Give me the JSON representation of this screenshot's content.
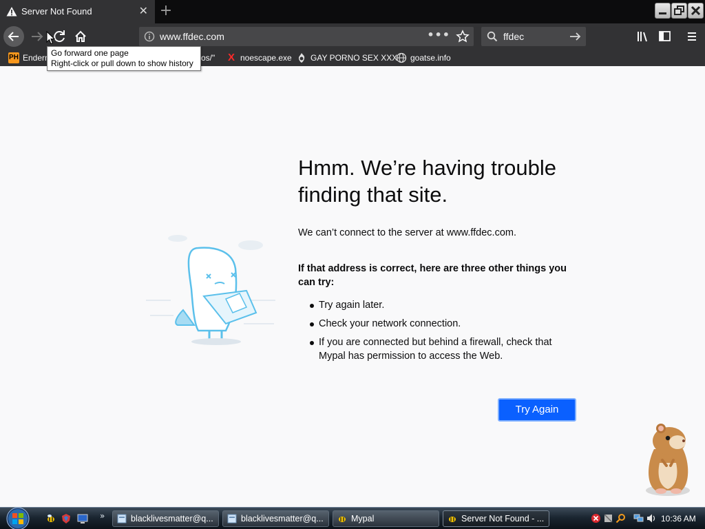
{
  "tab": {
    "title": "Server Not Found"
  },
  "navbar": {
    "url_host": "www.ffdec.com",
    "search_value": "ffdec"
  },
  "bookmarks": [
    {
      "label": "Endern"
    },
    {
      "label": "os/\""
    },
    {
      "label": "noescape.exe"
    },
    {
      "label": "GAY PORNO SEX XXX"
    },
    {
      "label": "goatse.info"
    }
  ],
  "bookmark_icons": {
    "ph": "PH",
    "x": "X"
  },
  "tooltip": {
    "line1": "Go forward one page",
    "line2": "Right-click or pull down to show history"
  },
  "error": {
    "title": "Hmm. We’re having trouble finding that site.",
    "short": "We can’t connect to the server at www.ffdec.com.",
    "bold": "If that address is correct, here are three other things you can try:",
    "items": [
      "Try again later.",
      "Check your network connection.",
      "If you are connected but behind a firewall, check that Mypal has permission to access the Web."
    ],
    "button": "Try Again"
  },
  "taskbar": {
    "buttons": [
      {
        "label": "blacklivesmatter@q..."
      },
      {
        "label": "blacklivesmatter@q..."
      },
      {
        "label": "Mypal"
      },
      {
        "label": "Server Not Found - ..."
      }
    ],
    "more": "»",
    "clock": "10:36 AM"
  },
  "colors": {
    "accent": "#0a60ff",
    "chrome": "#323234",
    "tabstrip": "#0c0c0d"
  }
}
